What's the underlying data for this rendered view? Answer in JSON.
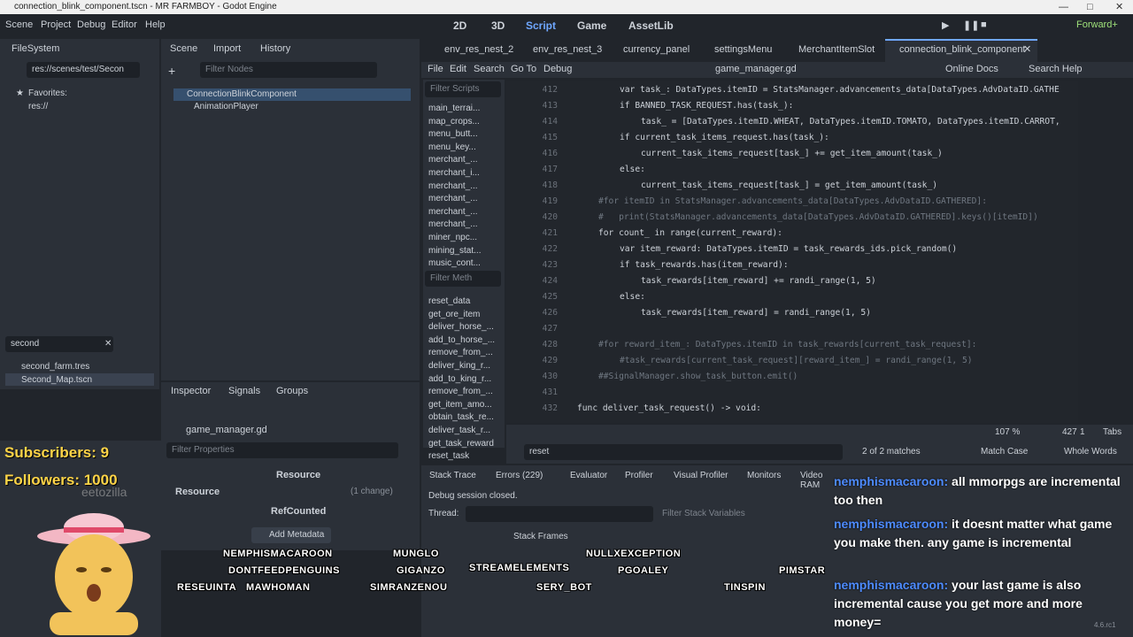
{
  "titlebar": {
    "text": "connection_blink_component.tscn - MR FARMBOY - Godot Engine"
  },
  "menu": {
    "scene": "Scene",
    "project": "Project",
    "debug": "Debug",
    "editor": "Editor",
    "help": "Help"
  },
  "workspaces": {
    "w2d": "2D",
    "w3d": "3D",
    "script": "Script",
    "game": "Game",
    "assetlib": "AssetLib"
  },
  "renderer": "Forward+",
  "filesystem": {
    "tab": "FileSystem",
    "path": "res://scenes/test/Secon",
    "favorites": "Favorites:",
    "res": "res://",
    "search": "second",
    "files": [
      "second_farm.tres",
      "Second_Map.tscn"
    ]
  },
  "scene_panel": {
    "tabs": [
      "Scene",
      "Import",
      "History"
    ],
    "filter_placeholder": "Filter Nodes",
    "root": "ConnectionBlinkComponent",
    "child": "AnimationPlayer"
  },
  "inspector": {
    "tabs": [
      "Inspector",
      "Signals",
      "Groups"
    ],
    "file": "game_manager.gd",
    "filter_placeholder": "Filter Properties",
    "resource_header": "Resource",
    "resource_row": "Resource",
    "change": "(1 change)",
    "refcounted": "RefCounted",
    "add_metadata": "Add Metadata"
  },
  "script_tabs": [
    "env_res_nest_2",
    "env_res_nest_3",
    "currency_panel",
    "settingsMenu",
    "MerchantItemSlot",
    "connection_blink_component"
  ],
  "script_menu": {
    "file": "File",
    "edit": "Edit",
    "search": "Search",
    "goto": "Go To",
    "debug": "Debug",
    "filename": "game_manager.gd",
    "online_docs": "Online Docs",
    "search_help": "Search Help"
  },
  "script_list": {
    "filter_placeholder": "Filter Scripts",
    "items": [
      "main_terrai...",
      "map_crops...",
      "menu_butt...",
      "menu_key...",
      "merchant_...",
      "merchant_i...",
      "merchant_...",
      "merchant_...",
      "merchant_...",
      "merchant_...",
      "miner_npc...",
      "mining_stat...",
      "music_cont..."
    ]
  },
  "method_list": {
    "filter_placeholder": "Filter Meth",
    "items": [
      "reset_data",
      "get_ore_item",
      "deliver_horse_...",
      "add_to_horse_...",
      "remove_from_...",
      "deliver_king_r...",
      "add_to_king_r...",
      "remove_from_...",
      "get_item_amo...",
      "obtain_task_re...",
      "deliver_task_r...",
      "get_task_reward",
      "reset_task"
    ]
  },
  "code_lines": [
    {
      "n": "412",
      "t": "var task_: DataTypes.itemID = StatsManager.advancements_data[DataTypes.AdvDataID.GATHE"
    },
    {
      "n": "413",
      "t": "if BANNED_TASK_REQUEST.has(task_):"
    },
    {
      "n": "414",
      "t": "task_ = [DataTypes.itemID.WHEAT, DataTypes.itemID.TOMATO, DataTypes.itemID.CARROT,"
    },
    {
      "n": "415",
      "t": "if current_task_items_request.has(task_):"
    },
    {
      "n": "416",
      "t": "current_task_items_request[task_] += get_item_amount(task_)"
    },
    {
      "n": "417",
      "t": "else:"
    },
    {
      "n": "418",
      "t": "current_task_items_request[task_] = get_item_amount(task_)"
    },
    {
      "n": "419",
      "t": "#for itemID in StatsManager.advancements_data[DataTypes.AdvDataID.GATHERED]:"
    },
    {
      "n": "420",
      "t": "#   print(StatsManager.advancements_data[DataTypes.AdvDataID.GATHERED].keys()[itemID])"
    },
    {
      "n": "421",
      "t": "for count_ in range(current_reward):"
    },
    {
      "n": "422",
      "t": "var item_reward: DataTypes.itemID = task_rewards_ids.pick_random()"
    },
    {
      "n": "423",
      "t": "if task_rewards.has(item_reward):"
    },
    {
      "n": "424",
      "t": "task_rewards[item_reward] += randi_range(1, 5)"
    },
    {
      "n": "425",
      "t": "else:"
    },
    {
      "n": "426",
      "t": "task_rewards[item_reward] = randi_range(1, 5)"
    },
    {
      "n": "427",
      "t": ""
    },
    {
      "n": "428",
      "t": "#for reward_item_: DataTypes.itemID in task_rewards[current_task_request]:"
    },
    {
      "n": "429",
      "t": "#task_rewards[current_task_request][reward_item_] = randi_range(1, 5)"
    },
    {
      "n": "430",
      "t": "##SignalManager.show_task_button.emit()"
    },
    {
      "n": "431",
      "t": ""
    },
    {
      "n": "432",
      "t": "func deliver_task_request() -> void:"
    }
  ],
  "findbar": {
    "query": "reset",
    "matches": "2 of 2 matches",
    "match_case": "Match Case",
    "whole_words": "Whole Words",
    "zoom": "107 %",
    "line": "427",
    "col": "1",
    "tabs": "Tabs"
  },
  "debugger": {
    "tabs": [
      "Stack Trace",
      "Errors (229)",
      "Evaluator",
      "Profiler",
      "Visual Profiler",
      "Monitors",
      "Video RAM"
    ],
    "status": "Debug session closed.",
    "thread_label": "Thread:",
    "filter_vars": "Filter Stack Variables",
    "stack_frames": "Stack Frames"
  },
  "overlay": {
    "subscribers": "Subscribers: 9",
    "followers": "Followers: 1000",
    "avatar_caption": "eetozilla"
  },
  "viewers": [
    "NEMPHISMACAROON",
    "DONTFEEDPENGUINS",
    "RESEUINTA",
    "MAWHOMAN",
    "MUNGLO",
    "GIGANZO",
    "SIMRANZENOU",
    "STREAMELEMENTS",
    "NULLXEXCEPTION",
    "PGOALEY",
    "SERY_BOT",
    "TINSPIN",
    "PIMSTAR"
  ],
  "chat": [
    {
      "user": "nemphismacaroon:",
      "msg": "all mmorpgs are incremental too then"
    },
    {
      "user": "nemphismacaroon:",
      "msg": "it doesnt matter what game you make then. any game is incremental"
    },
    {
      "user": "nemphismacaroon:",
      "msg": "your last game is also incremental cause you get more and more money="
    }
  ],
  "version": "4.6.rc1"
}
